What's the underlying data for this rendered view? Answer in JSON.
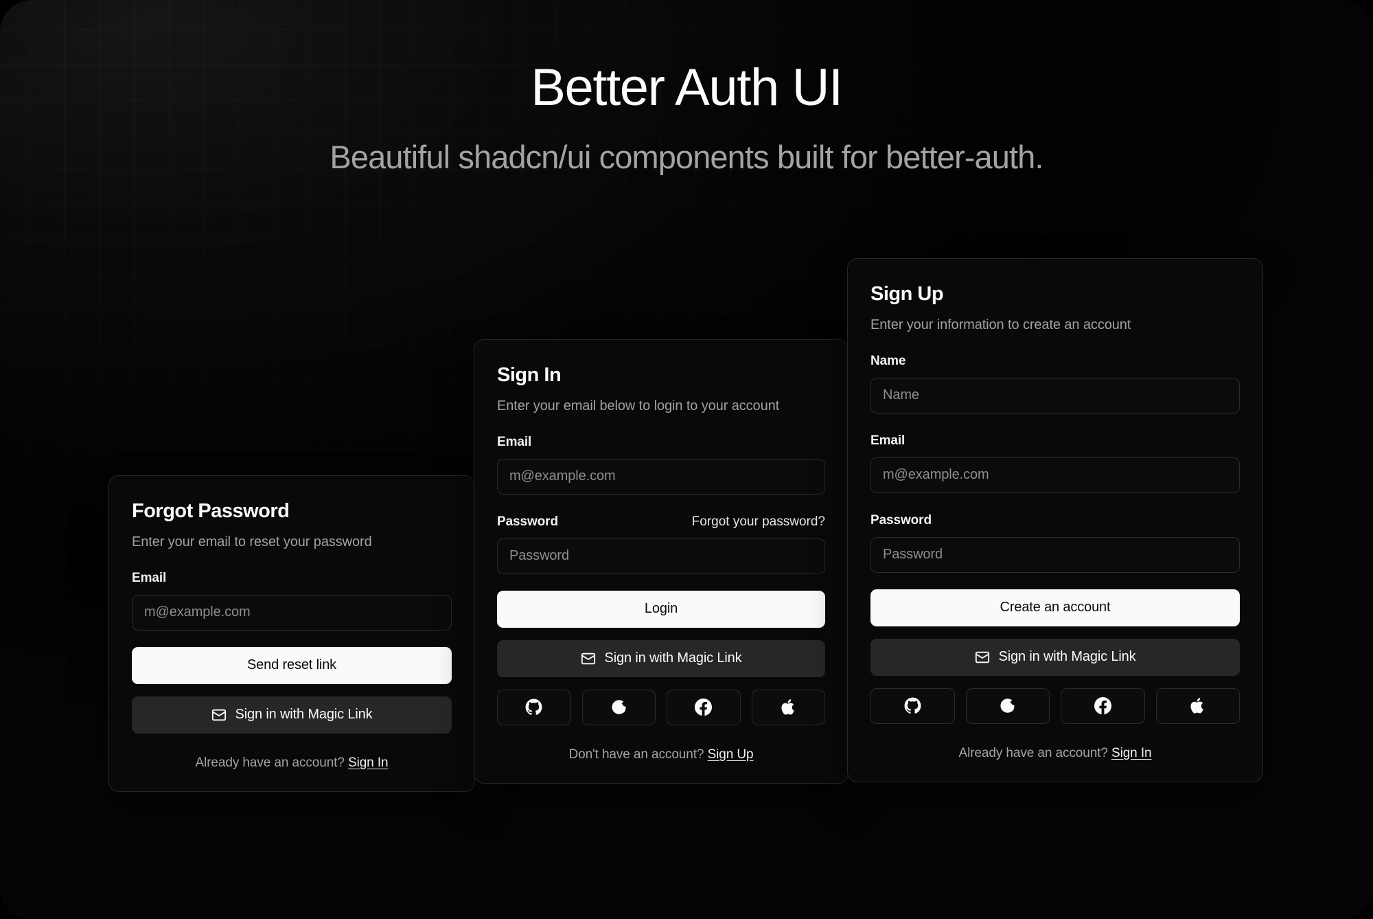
{
  "hero": {
    "title": "Better Auth UI",
    "subtitle": "Beautiful shadcn/ui components built for better-auth."
  },
  "theme": {
    "page_bg": "#080808",
    "card_bg": "#090909",
    "card_border": "#272727",
    "primary_button_bg": "#fafafa",
    "primary_button_text": "#0a0a0a",
    "secondary_button_bg": "#272727",
    "muted_text": "#a1a1a1",
    "placeholder_text": "#8e8e8e"
  },
  "cards": {
    "forgot_password": {
      "title": "Forgot Password",
      "description": "Enter your email to reset your password",
      "email_label": "Email",
      "email_placeholder": "m@example.com",
      "submit_label": "Send reset link",
      "magic_link_label": "Sign in with Magic Link",
      "magic_link_icon": "envelope-icon",
      "footer_text": "Already have an account?",
      "footer_link": "Sign In"
    },
    "sign_in": {
      "title": "Sign In",
      "description": "Enter your email below to login to your account",
      "email_label": "Email",
      "email_placeholder": "m@example.com",
      "password_label": "Password",
      "password_placeholder": "Password",
      "forgot_link": "Forgot your password?",
      "submit_label": "Login",
      "magic_link_label": "Sign in with Magic Link",
      "magic_link_icon": "envelope-icon",
      "social_providers": [
        "github-icon",
        "google-icon",
        "facebook-icon",
        "apple-icon"
      ],
      "footer_text": "Don't have an account?",
      "footer_link": "Sign Up"
    },
    "sign_up": {
      "title": "Sign Up",
      "description": "Enter your information to create an account",
      "name_label": "Name",
      "name_placeholder": "Name",
      "email_label": "Email",
      "email_placeholder": "m@example.com",
      "password_label": "Password",
      "password_placeholder": "Password",
      "submit_label": "Create an account",
      "magic_link_label": "Sign in with Magic Link",
      "magic_link_icon": "envelope-icon",
      "social_providers": [
        "github-icon",
        "google-icon",
        "facebook-icon",
        "apple-icon"
      ],
      "footer_text": "Already have an account?",
      "footer_link": "Sign In"
    }
  }
}
